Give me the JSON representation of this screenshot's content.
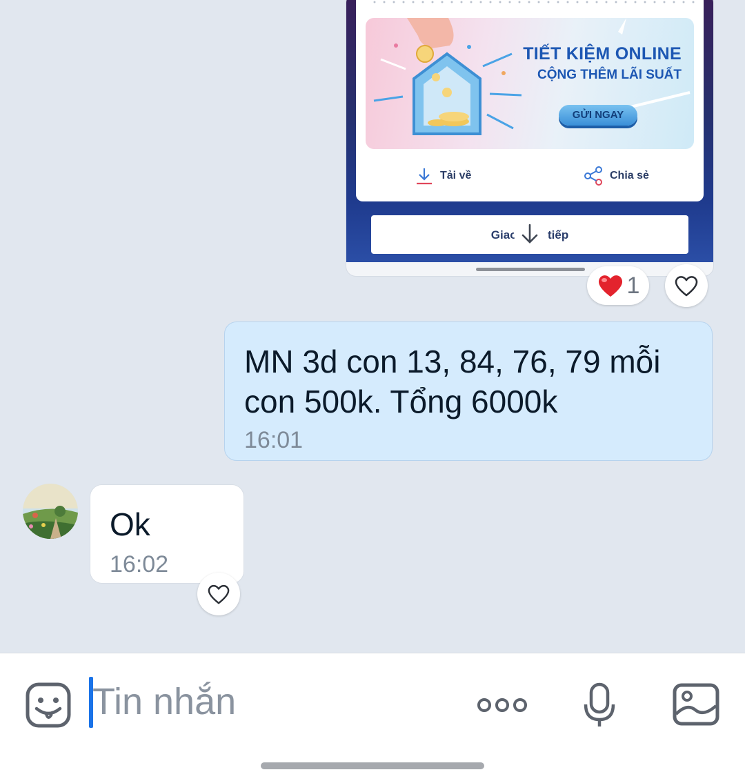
{
  "image_message": {
    "banner_title": "TIẾT KIỆM ONLINE",
    "banner_subtitle": "CỘNG THÊM LÃI SUẤT",
    "banner_button": "GỬI NGAY",
    "download_label": "Tải về",
    "share_label": "Chia sẻ",
    "continue_button": "Giao dịch tiếp",
    "reaction_count": "1"
  },
  "messages": [
    {
      "direction": "outgoing",
      "text": "MN 3d con 13, 84, 76, 79 mỗi con 500k. Tổng 6000k",
      "time": "16:01"
    },
    {
      "direction": "incoming",
      "text": "Ok",
      "time": "16:02"
    }
  ],
  "input": {
    "placeholder": "Tin nhắn"
  },
  "colors": {
    "accent": "#1a73e8",
    "outgoing_bubble": "#d5ebfd",
    "background": "#e1e7ef"
  }
}
